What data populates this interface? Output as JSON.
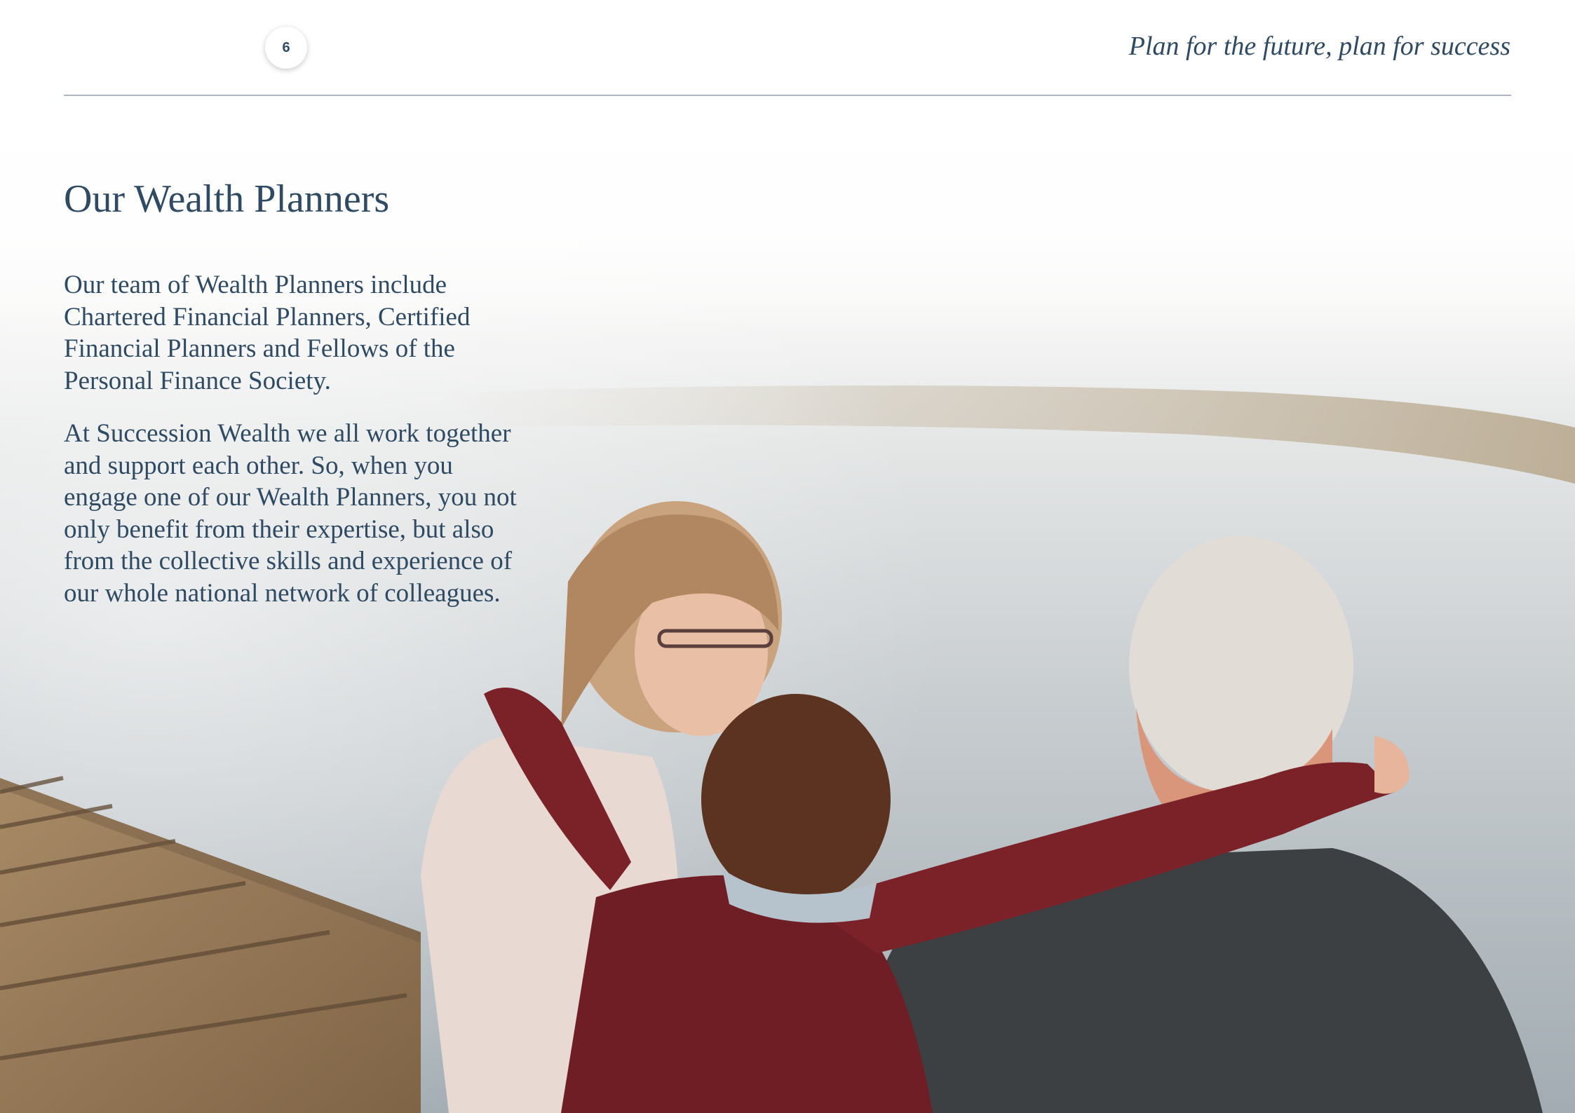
{
  "header": {
    "page_number": "6",
    "tagline": "Plan for the future, plan for success"
  },
  "main": {
    "title": "Our Wealth Planners",
    "paragraphs": [
      "Our team of Wealth Planners include Chartered Financial Planners, Certified Financial Planners and Fellows of the Personal Finance Society.",
      "At Succession Wealth we all work together and support each other. So, when you engage one of our Wealth Planners, you not only benefit from their expertise, but also from the collective skills and experience of our whole national network of colleagues."
    ]
  },
  "photo": {
    "subject": "family-on-jetty-photo"
  },
  "colors": {
    "text": "#2f4a63",
    "rule": "#a9b7c6"
  }
}
